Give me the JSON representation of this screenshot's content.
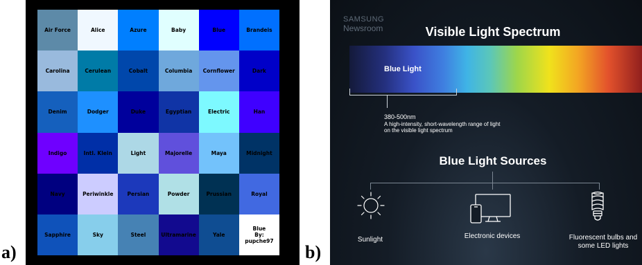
{
  "panel_a": {
    "label": "a)",
    "swatches": [
      {
        "name": "Air Force",
        "bg": "#5d8aa8",
        "fg": "#000000"
      },
      {
        "name": "Alice",
        "bg": "#f0f8ff",
        "fg": "#000000"
      },
      {
        "name": "Azure",
        "bg": "#007fff",
        "fg": "#000000"
      },
      {
        "name": "Baby",
        "bg": "#e0ffff",
        "fg": "#000000"
      },
      {
        "name": "Blue",
        "bg": "#0000ff",
        "fg": "#000000"
      },
      {
        "name": "Brandeis",
        "bg": "#0070ff",
        "fg": "#000000"
      },
      {
        "name": "Carolina",
        "bg": "#99badd",
        "fg": "#000000"
      },
      {
        "name": "Cerulean",
        "bg": "#007ba7",
        "fg": "#000000"
      },
      {
        "name": "Cobalt",
        "bg": "#0047ab",
        "fg": "#000000"
      },
      {
        "name": "Columbia",
        "bg": "#6fa8dc",
        "fg": "#000000"
      },
      {
        "name": "Cornflower",
        "bg": "#6495ed",
        "fg": "#000000"
      },
      {
        "name": "Dark",
        "bg": "#0000c8",
        "fg": "#000000"
      },
      {
        "name": "Denim",
        "bg": "#1560bd",
        "fg": "#000000"
      },
      {
        "name": "Dodger",
        "bg": "#1e90ff",
        "fg": "#000000"
      },
      {
        "name": "Duke",
        "bg": "#00009c",
        "fg": "#000000"
      },
      {
        "name": "Egyptian",
        "bg": "#1034a6",
        "fg": "#000000"
      },
      {
        "name": "Electric",
        "bg": "#7df9ff",
        "fg": "#000000"
      },
      {
        "name": "Han",
        "bg": "#3f00ff",
        "fg": "#000000"
      },
      {
        "name": "Indigo",
        "bg": "#6f00ff",
        "fg": "#000000"
      },
      {
        "name": "Intl. Klein",
        "bg": "#002fa7",
        "fg": "#000000"
      },
      {
        "name": "Light",
        "bg": "#add8e6",
        "fg": "#000000"
      },
      {
        "name": "Majorelle",
        "bg": "#6050dc",
        "fg": "#000000"
      },
      {
        "name": "Maya",
        "bg": "#73c2fb",
        "fg": "#000000"
      },
      {
        "name": "Midnight",
        "bg": "#003366",
        "fg": "#000000"
      },
      {
        "name": "Navy",
        "bg": "#000080",
        "fg": "#000000"
      },
      {
        "name": "Periwinkle",
        "bg": "#ccccff",
        "fg": "#000000"
      },
      {
        "name": "Persian",
        "bg": "#1c39bb",
        "fg": "#000000"
      },
      {
        "name": "Powder",
        "bg": "#b0e0e6",
        "fg": "#000000"
      },
      {
        "name": "Prussian",
        "bg": "#003153",
        "fg": "#000000"
      },
      {
        "name": "Royal",
        "bg": "#4169e1",
        "fg": "#000000"
      },
      {
        "name": "Sapphire",
        "bg": "#0f52ba",
        "fg": "#000000"
      },
      {
        "name": "Sky",
        "bg": "#87ceeb",
        "fg": "#000000"
      },
      {
        "name": "Steel",
        "bg": "#4682b4",
        "fg": "#000000"
      },
      {
        "name": "Ultramarine",
        "bg": "#120a8f",
        "fg": "#000000"
      },
      {
        "name": "Yale",
        "bg": "#0f4d92",
        "fg": "#000000"
      },
      {
        "name": "Blue\nBy:\npupche97",
        "bg": "#ffffff",
        "fg": "#000000"
      }
    ]
  },
  "panel_b": {
    "label": "b)",
    "brand_line1": "SAMSUNG",
    "brand_line2": "Newsroom",
    "title": "Visible Light Spectrum",
    "blue_light_label": "Blue Light",
    "range": "380-500nm",
    "range_description": "A high-intensity, short-wavelength range of light\non the visible light spectrum",
    "sources_title": "Blue Light Sources",
    "sources": [
      {
        "label": "Sunlight",
        "icon": "sun-icon"
      },
      {
        "label": "Electronic devices",
        "icon": "device-icon"
      },
      {
        "label": "Fluorescent bulbs and\nsome LED lights",
        "icon": "bulb-icon"
      }
    ],
    "colors": {
      "background": "#141c26",
      "text": "#ffffff",
      "brand": "#5f6b78"
    }
  }
}
